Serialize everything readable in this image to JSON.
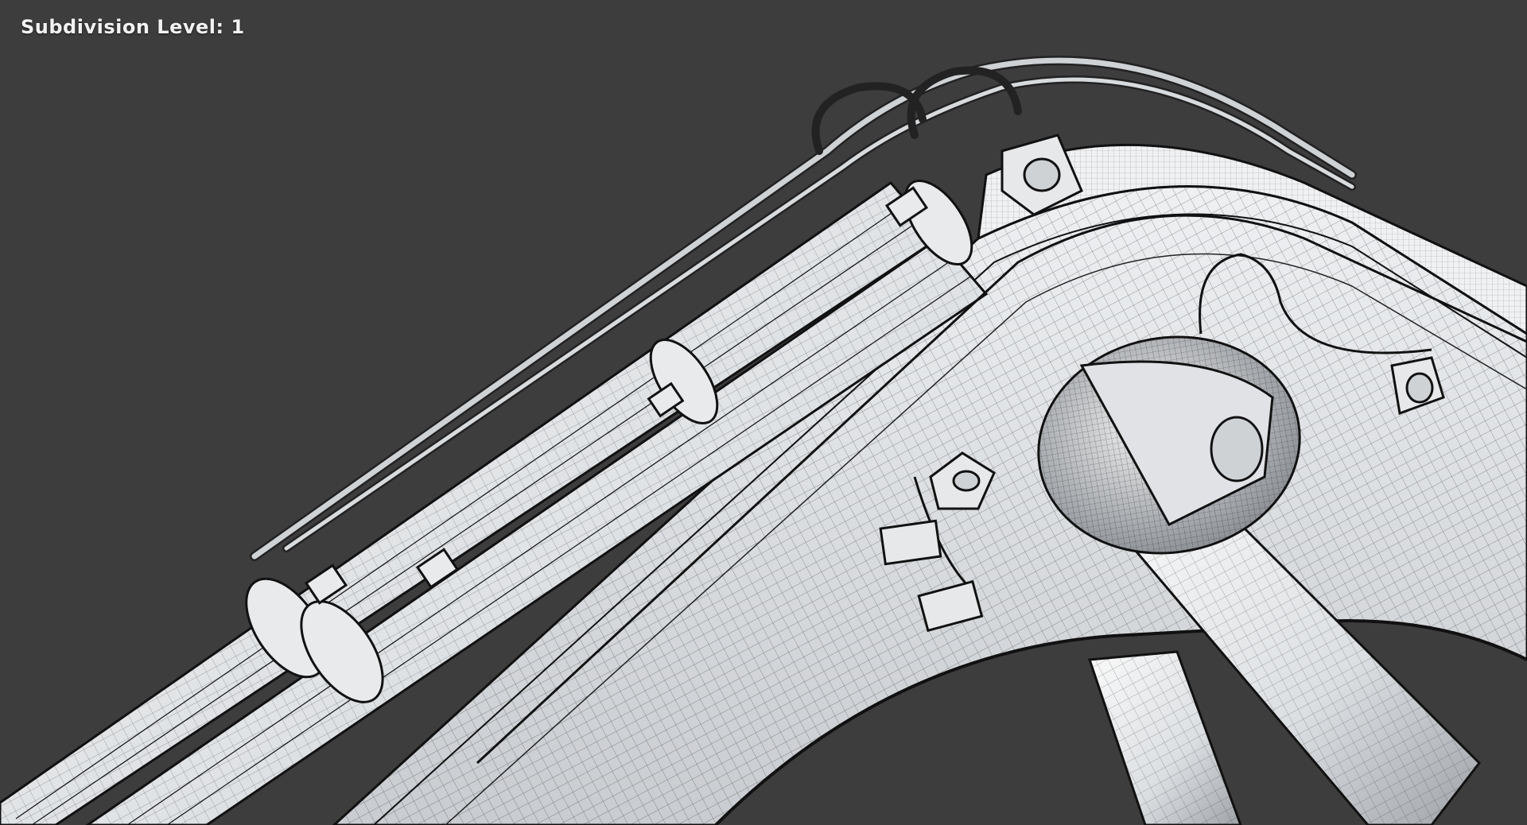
{
  "viewport": {
    "overlay_label": "Subdivision Level: 1",
    "background_color": "#3d3d3d",
    "model_fill_color": "#e4e6e8",
    "wire_color": "#141414",
    "icons": [
      "excavator-boom-model",
      "hydraulic-cylinder",
      "hose-bundle",
      "pivot-joint"
    ]
  }
}
